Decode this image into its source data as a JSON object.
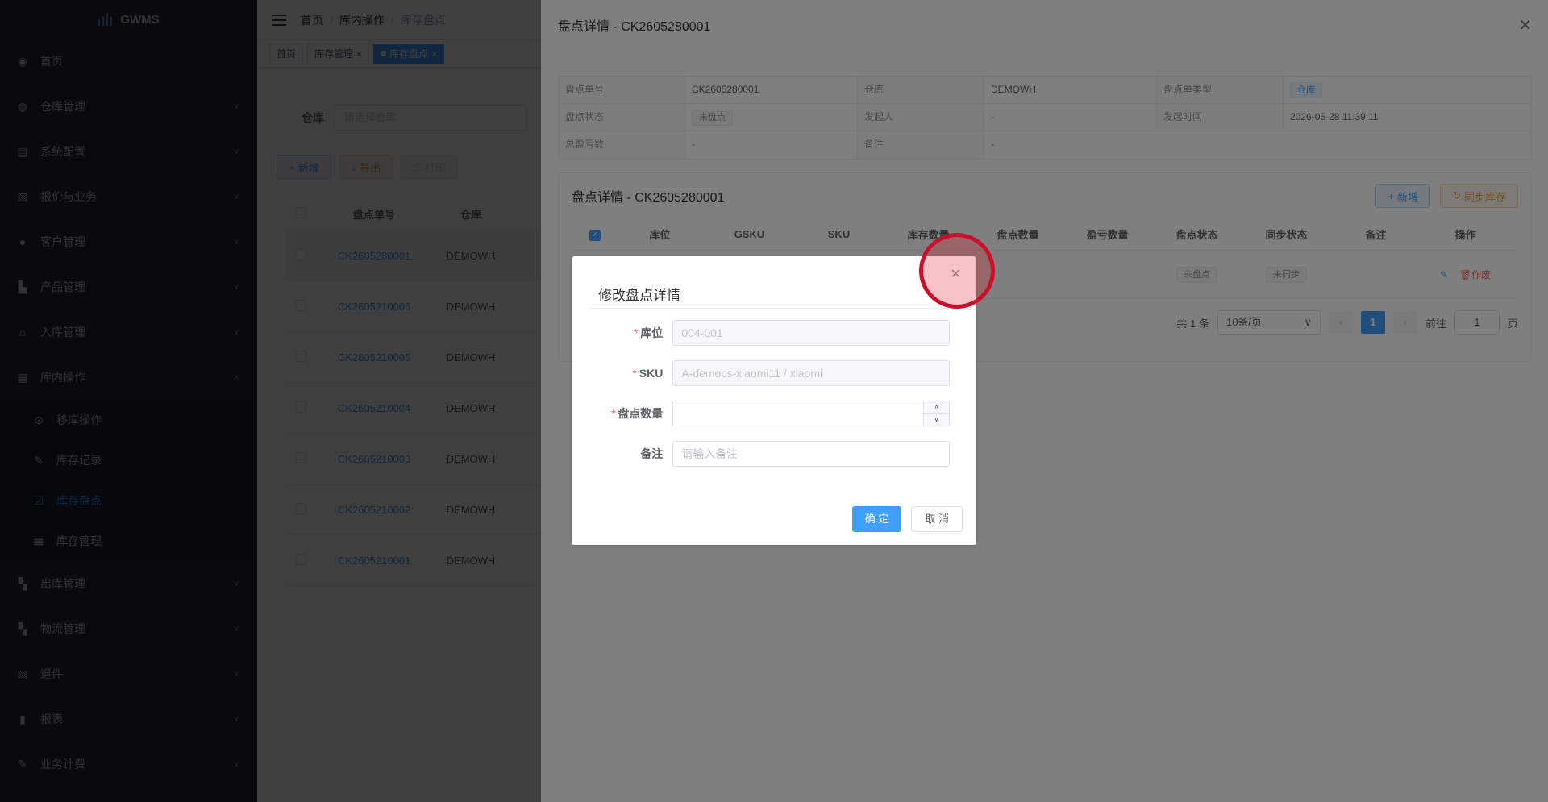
{
  "app": {
    "name": "GWMS"
  },
  "sidebar": {
    "items": [
      {
        "label": "首页",
        "icon": "dashboard-icon"
      },
      {
        "label": "仓库管理",
        "icon": "globe-icon"
      },
      {
        "label": "系统配置",
        "icon": "document-icon"
      },
      {
        "label": "报价与业务",
        "icon": "form-icon"
      },
      {
        "label": "客户管理",
        "icon": "user-icon"
      },
      {
        "label": "产品管理",
        "icon": "cart-icon"
      },
      {
        "label": "入库管理",
        "icon": "home-icon"
      },
      {
        "label": "库内操作",
        "icon": "grid-icon"
      }
    ],
    "subitems": [
      {
        "label": "移库操作",
        "icon": "toggle-icon"
      },
      {
        "label": "库存记录",
        "icon": "edit-icon"
      },
      {
        "label": "库存盘点",
        "icon": "checkbox-icon"
      },
      {
        "label": "库存管理",
        "icon": "table-icon"
      }
    ],
    "items2": [
      {
        "label": "出库管理",
        "icon": "apps-icon"
      },
      {
        "label": "物流管理",
        "icon": "apps-icon"
      },
      {
        "label": "退件",
        "icon": "form-icon"
      },
      {
        "label": "报表",
        "icon": "bar-chart-icon"
      },
      {
        "label": "业务计费",
        "icon": "edit-icon"
      }
    ]
  },
  "header": {
    "breadcrumb": [
      "首页",
      "库内操作",
      "库存盘点"
    ],
    "tags": [
      "首页",
      "库存管理",
      "库存盘点"
    ]
  },
  "filter": {
    "label": "仓库",
    "placeholder": "请选择仓库"
  },
  "toolbar": {
    "add": "新增",
    "export": "导出",
    "print": "打印"
  },
  "list": {
    "headers": [
      "盘点单号",
      "仓库"
    ],
    "rows": [
      {
        "no": "CK2605280001",
        "wh": "DEMOWH"
      },
      {
        "no": "CK2605210006",
        "wh": "DEMOWH"
      },
      {
        "no": "CK2605210005",
        "wh": "DEMOWH"
      },
      {
        "no": "CK2605210004",
        "wh": "DEMOWH"
      },
      {
        "no": "CK2605210003",
        "wh": "DEMOWH"
      },
      {
        "no": "CK2605210002",
        "wh": "DEMOWH"
      },
      {
        "no": "CK2605210001",
        "wh": "DEMOWH"
      }
    ]
  },
  "drawer": {
    "title": "盘点详情 - CK2605280001",
    "desc": {
      "k_no": "盘点单号",
      "v_no": "CK2605280001",
      "k_wh": "仓库",
      "v_wh": "DEMOWH",
      "k_type": "盘点单类型",
      "v_type": "仓库",
      "k_status": "盘点状态",
      "v_status": "未盘点",
      "k_initiator": "发起人",
      "v_initiator": "-",
      "k_time": "发起时间",
      "v_time": "2026-05-28 11:39:11",
      "k_total": "总盈亏数",
      "v_total": "-",
      "k_remark": "备注",
      "v_remark": "-"
    },
    "card": {
      "title": "盘点详情 - CK2605280001",
      "add": "新增",
      "sync": "同步库存",
      "headers": [
        "库位",
        "GSKU",
        "SKU",
        "库存数量",
        "盘点数量",
        "盈亏数量",
        "盘点状态",
        "同步状态",
        "备注",
        "操作"
      ],
      "row": {
        "status": "未盘点",
        "sync": "未同步",
        "void": "作废"
      },
      "pager": {
        "total": "共 1 条",
        "size": "10条/页",
        "page": "1",
        "goto": "前往",
        "goto_val": "1",
        "unit": "页"
      }
    }
  },
  "dialog": {
    "title": "修改盘点详情",
    "fields": {
      "loc_label": "库位",
      "loc_value": "004-001",
      "sku_label": "SKU",
      "sku_value": "A-democs-xiaomi11 / xiaomi",
      "qty_label": "盘点数量",
      "qty_value": "",
      "remark_label": "备注",
      "remark_placeholder": "请输入备注"
    },
    "ok": "确 定",
    "cancel": "取 消"
  }
}
